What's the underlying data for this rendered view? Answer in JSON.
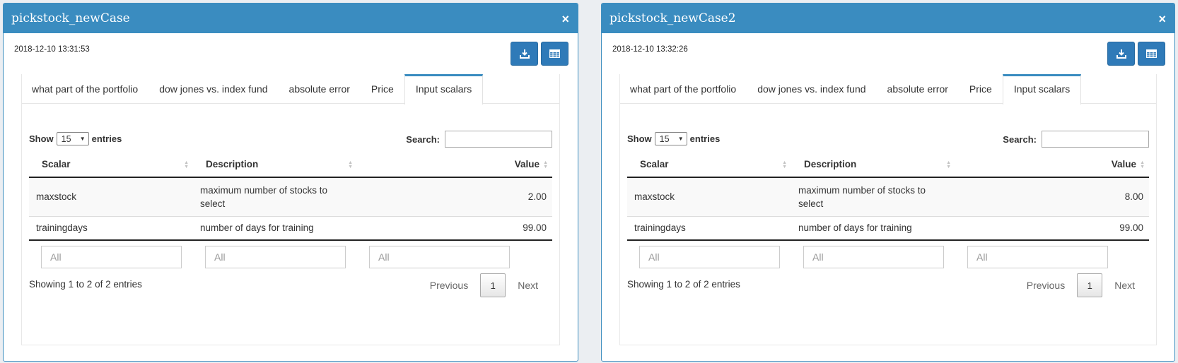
{
  "panels": [
    {
      "title": "pickstock_newCase",
      "close": "×",
      "timestamp": "2018-12-10 13:31:53",
      "tabs": [
        "what part of the portfolio",
        "dow jones vs. index fund",
        "absolute error",
        "Price",
        "Input scalars"
      ],
      "active_tab": "Input scalars",
      "show_label": "Show",
      "page_size": "15",
      "entries_label": "entries",
      "search_label": "Search:",
      "columns": [
        "Scalar",
        "Description",
        "Value"
      ],
      "rows": [
        {
          "scalar": "maxstock",
          "desc1": "maximum number of stocks to",
          "desc2": "select",
          "value": "2.00"
        },
        {
          "scalar": "trainingdays",
          "desc1": "number of days for training",
          "desc2": "",
          "value": "99.00"
        }
      ],
      "filter_placeholder": "All",
      "info": "Showing 1 to 2 of 2 entries",
      "prev": "Previous",
      "page": "1",
      "next": "Next"
    },
    {
      "title": "pickstock_newCase2",
      "close": "×",
      "timestamp": "2018-12-10 13:32:26",
      "tabs": [
        "what part of the portfolio",
        "dow jones vs. index fund",
        "absolute error",
        "Price",
        "Input scalars"
      ],
      "active_tab": "Input scalars",
      "show_label": "Show",
      "page_size": "15",
      "entries_label": "entries",
      "search_label": "Search:",
      "columns": [
        "Scalar",
        "Description",
        "Value"
      ],
      "rows": [
        {
          "scalar": "maxstock",
          "desc1": "maximum number of stocks to",
          "desc2": "select",
          "value": "8.00"
        },
        {
          "scalar": "trainingdays",
          "desc1": "number of days for training",
          "desc2": "",
          "value": "99.00"
        }
      ],
      "filter_placeholder": "All",
      "info": "Showing 1 to 2 of 2 entries",
      "prev": "Previous",
      "page": "1",
      "next": "Next"
    }
  ],
  "colors": {
    "header": "#3a8cc0",
    "button": "#2f7ab8"
  },
  "icons": {
    "download": "download-icon",
    "table": "table-icon",
    "close": "close-icon"
  }
}
